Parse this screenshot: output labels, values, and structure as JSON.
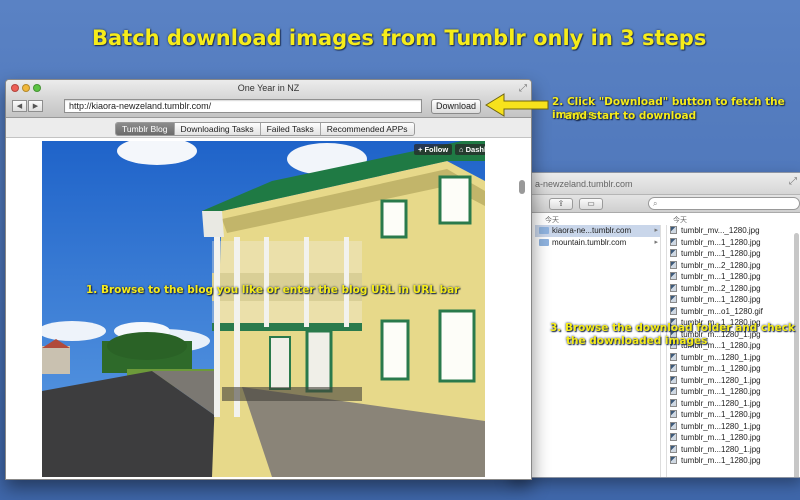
{
  "headline": "Batch download images from Tumblr only in 3 steps",
  "callouts": {
    "step1": "1. Browse to the blog you like or enter the blog URL in URL bar",
    "step2_line1": "2. Click \"Download\" button to fetch the images",
    "step2_line2": "and start to download",
    "step3_line1": "3. Browse the download folder and check",
    "step3_line2": "the downloaded images"
  },
  "main_window": {
    "title": "One Year in NZ",
    "url": "http://kiaora-newzeland.tumblr.com/",
    "download_label": "Download",
    "tabs": [
      {
        "label": "Tumblr Blog",
        "active": true
      },
      {
        "label": "Downloading Tasks",
        "active": false
      },
      {
        "label": "Failed Tasks",
        "active": false
      },
      {
        "label": "Recommended APPs",
        "active": false
      }
    ],
    "follow_label": "Follow",
    "dashboard_label": "Dashboard"
  },
  "finder_window": {
    "title": "a-newzeland.tumblr.com",
    "col1_header": "今天",
    "col2_header": "今天",
    "folders": [
      {
        "name": "kiaora-ne...tumblr.com",
        "selected": true
      },
      {
        "name": "mountain.tumblr.com",
        "selected": false
      }
    ],
    "files": [
      "tumblr_mv..._1280.jpg",
      "tumblr_m...1_1280.jpg",
      "tumblr_m...1_1280.jpg",
      "tumblr_m...2_1280.jpg",
      "tumblr_m...1_1280.jpg",
      "tumblr_m...2_1280.jpg",
      "tumblr_m...1_1280.jpg",
      "tumblr_m...o1_1280.gif",
      "tumblr_m...1_1280.jpg",
      "tumblr_m...1280_1.jpg",
      "tumblr_m...1_1280.jpg",
      "tumblr_m...1280_1.jpg",
      "tumblr_m...1_1280.jpg",
      "tumblr_m...1280_1.jpg",
      "tumblr_m...1_1280.jpg",
      "tumblr_m...1280_1.jpg",
      "tumblr_m...1_1280.jpg",
      "tumblr_m...1280_1.jpg",
      "tumblr_m...1_1280.jpg",
      "tumblr_m...1280_1.jpg",
      "tumblr_m...1_1280.jpg"
    ]
  },
  "colors": {
    "background": "#4a72b6",
    "callout_yellow": "#f6ec1a",
    "arrow_yellow": "#f7e21c"
  }
}
